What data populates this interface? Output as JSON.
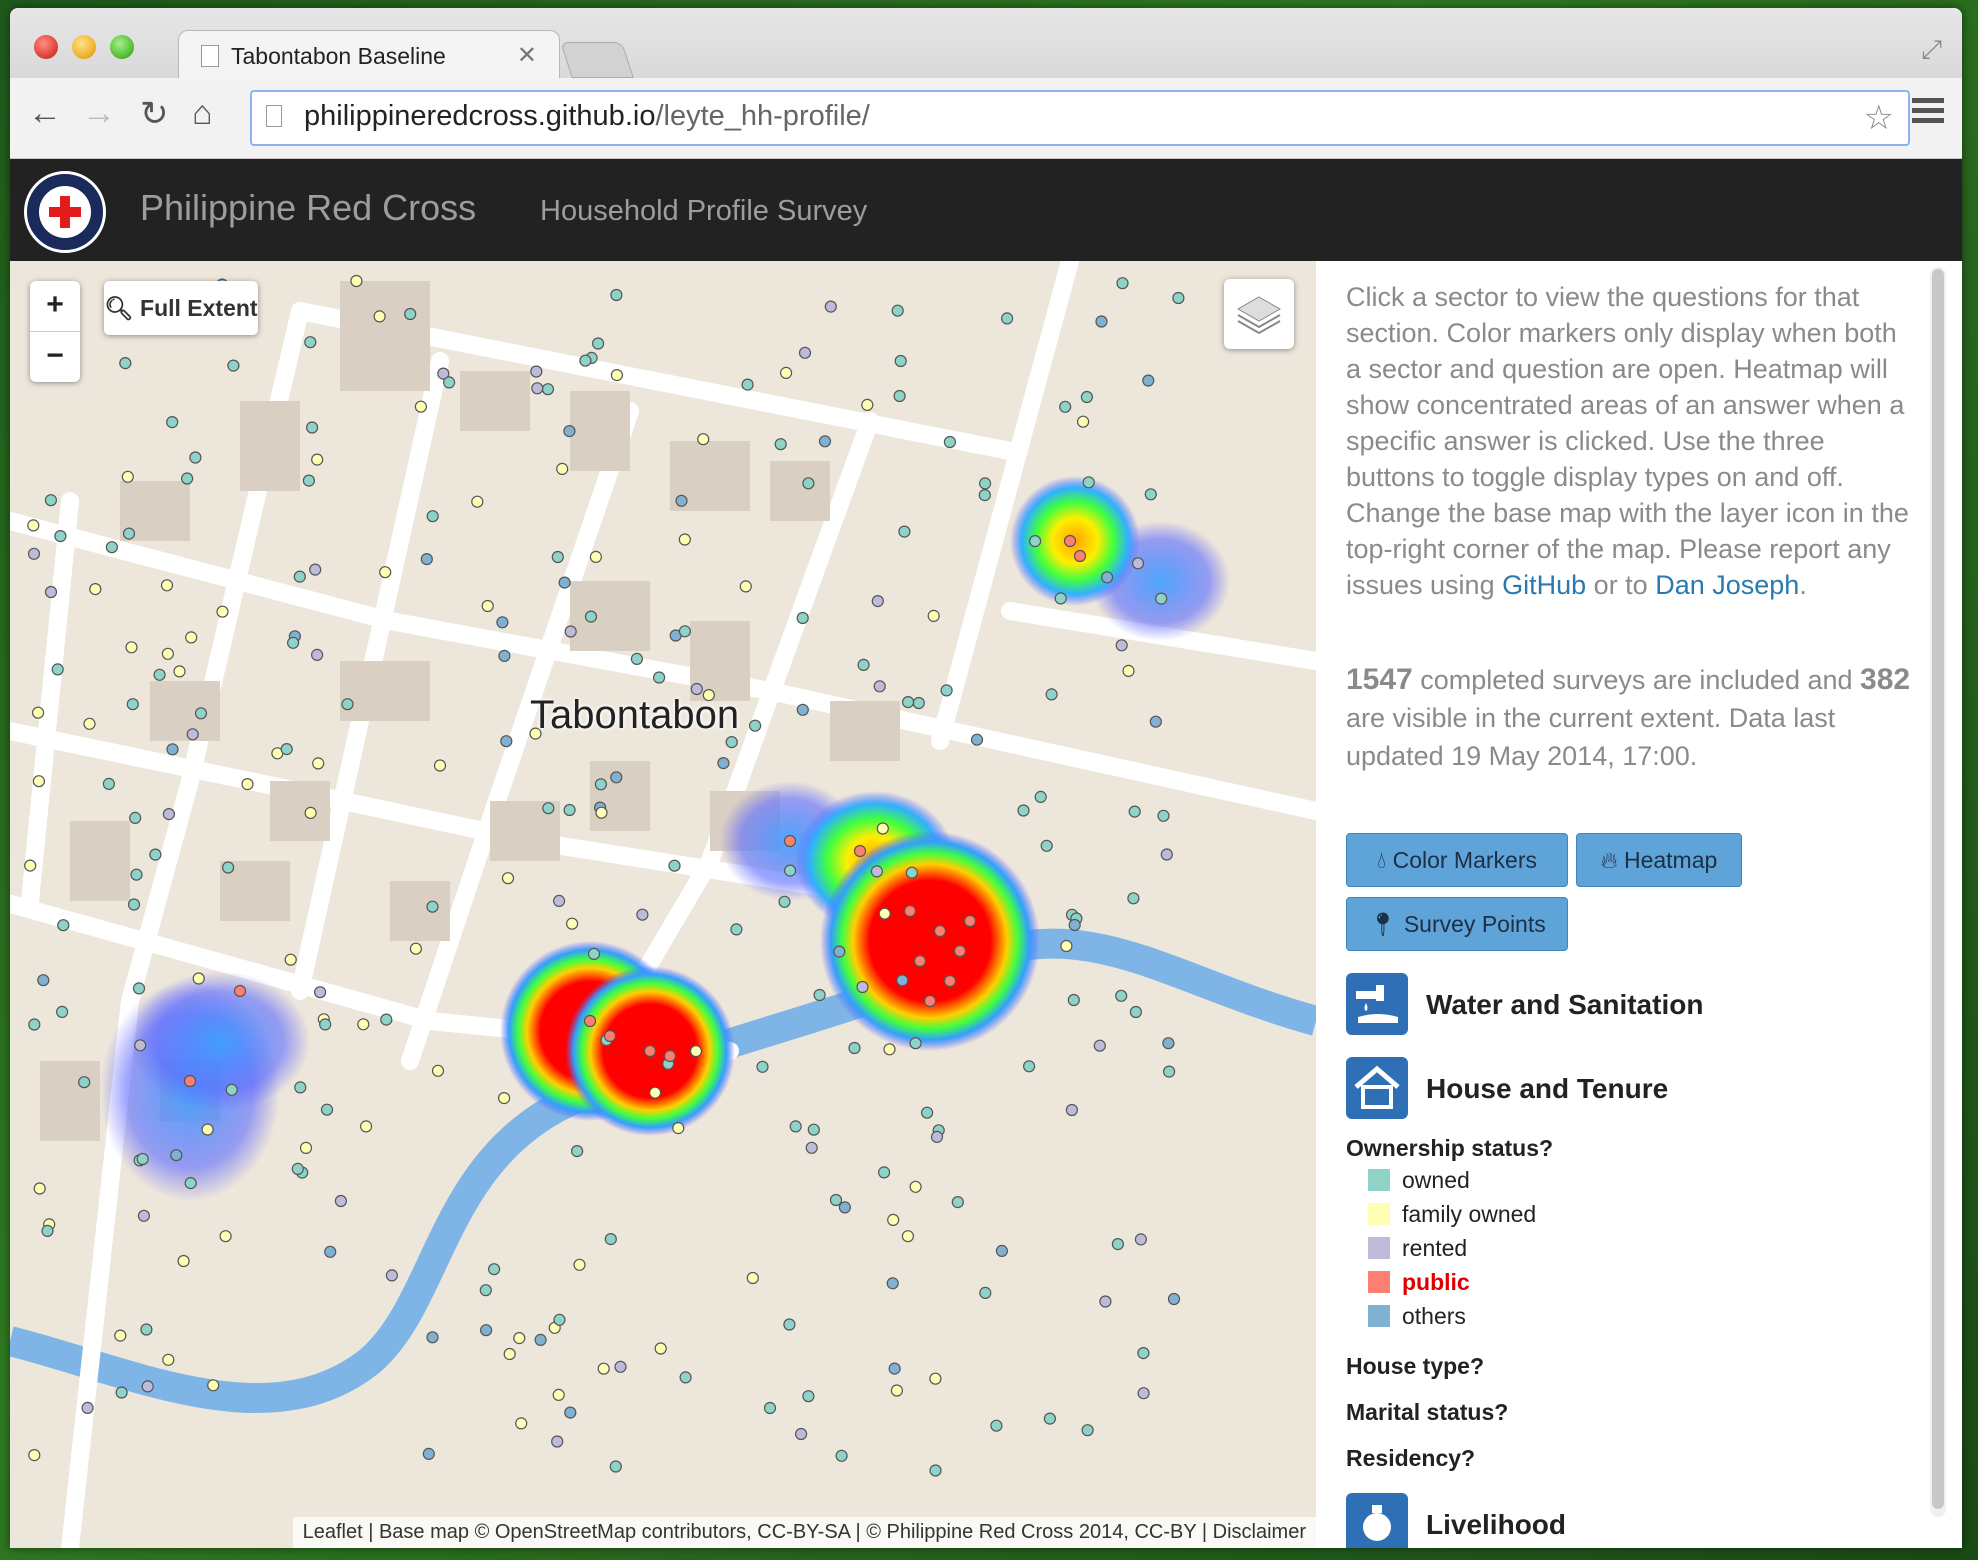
{
  "browser": {
    "tab_title": "Tabontabon Baseline",
    "url_host": "philippineredcross.github.io",
    "url_path": "/leyte_hh-profile/"
  },
  "navbar": {
    "brand": "Philippine Red Cross",
    "link": "Household Profile Survey"
  },
  "map": {
    "full_extent_label": "Full Extent",
    "place_label": "Tabontabon",
    "attribution": {
      "leaflet": "Leaflet",
      "basemap_prefix": "Base map ©",
      "osm": "OpenStreetMap",
      "contributors": "contributors,",
      "cc_by_sa": "CC-BY-SA",
      "prc_prefix": "© Philippine Red Cross",
      "year": "2014,",
      "cc_by": "CC-BY",
      "disclaimer": "Disclaimer"
    },
    "colors": {
      "owned": "#8dd3c7",
      "family_owned": "#ffffb3",
      "rented": "#bebada",
      "public": "#fb8072",
      "others": "#80b1d3"
    }
  },
  "sidebar": {
    "intro_text": "Click a sector to view the questions for that section. Color markers only display when both a sector and question are open. Heatmap will show concentrated areas of an answer when a specific answer is clicked. Use the three buttons to toggle display types on and off. Change the base map with the layer icon in the top-right corner of the map. Please report any issues using",
    "github_link": "GitHub",
    "or_to": "or to",
    "dan_link": "Dan Joseph",
    "completed_count": "1547",
    "completed_text": "completed surveys are included and",
    "visible_count": "382",
    "visible_text": "are visible in the current extent. Data last updated 19 May 2014, 17:00.",
    "buttons": {
      "color_markers": "Color Markers",
      "heatmap": "Heatmap",
      "survey_points": "Survey Points"
    },
    "sectors": [
      "Water and Sanitation",
      "House and Tenure",
      "Livelihood"
    ],
    "questions": {
      "ownership": "Ownership status?",
      "house_type": "House type?",
      "marital": "Marital status?",
      "residency": "Residency?"
    },
    "legend": [
      {
        "label": "owned",
        "color": "#8dd3c7"
      },
      {
        "label": "family owned",
        "color": "#ffffb3"
      },
      {
        "label": "rented",
        "color": "#bebada"
      },
      {
        "label": "public",
        "color": "#fb8072",
        "active": true
      },
      {
        "label": "others",
        "color": "#80b1d3"
      }
    ]
  }
}
